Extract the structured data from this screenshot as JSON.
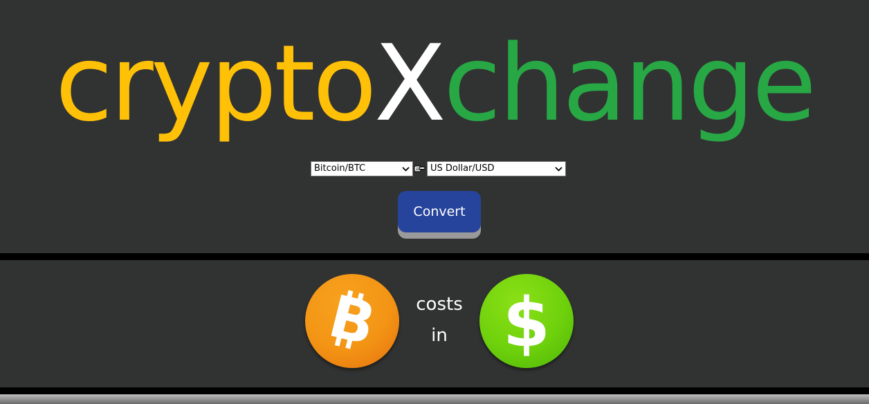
{
  "logo": {
    "part1": "crypto",
    "part2": "X",
    "part3": "change",
    "colors": {
      "part1": "#FFC107",
      "part2": "#FFFFFF",
      "part3": "#28A745"
    }
  },
  "converter": {
    "from_selected": "Bitcoin/BTC",
    "to_selected": "US Dollar/USD",
    "arrow_icon": "pointing-hand-right-icon",
    "convert_label": "Convert",
    "button_color": "#27449C"
  },
  "result": {
    "from_icon": "bitcoin-icon",
    "to_icon": "dollar-icon",
    "text_line1": "costs",
    "text_line2": "in"
  }
}
